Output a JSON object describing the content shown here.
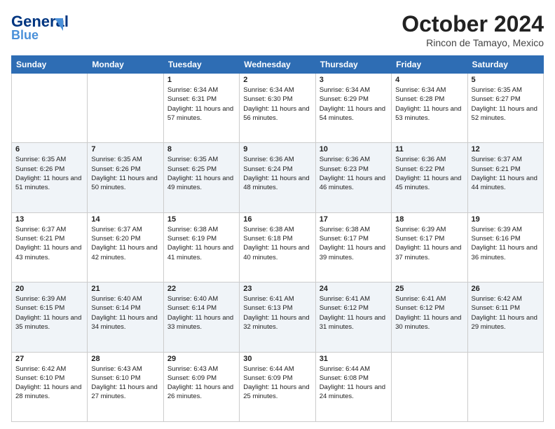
{
  "header": {
    "logo_line1": "General",
    "logo_line2": "Blue",
    "month": "October 2024",
    "location": "Rincon de Tamayo, Mexico"
  },
  "weekdays": [
    "Sunday",
    "Monday",
    "Tuesday",
    "Wednesday",
    "Thursday",
    "Friday",
    "Saturday"
  ],
  "weeks": [
    [
      {
        "day": "",
        "sunrise": "",
        "sunset": "",
        "daylight": ""
      },
      {
        "day": "",
        "sunrise": "",
        "sunset": "",
        "daylight": ""
      },
      {
        "day": "1",
        "sunrise": "Sunrise: 6:34 AM",
        "sunset": "Sunset: 6:31 PM",
        "daylight": "Daylight: 11 hours and 57 minutes."
      },
      {
        "day": "2",
        "sunrise": "Sunrise: 6:34 AM",
        "sunset": "Sunset: 6:30 PM",
        "daylight": "Daylight: 11 hours and 56 minutes."
      },
      {
        "day": "3",
        "sunrise": "Sunrise: 6:34 AM",
        "sunset": "Sunset: 6:29 PM",
        "daylight": "Daylight: 11 hours and 54 minutes."
      },
      {
        "day": "4",
        "sunrise": "Sunrise: 6:34 AM",
        "sunset": "Sunset: 6:28 PM",
        "daylight": "Daylight: 11 hours and 53 minutes."
      },
      {
        "day": "5",
        "sunrise": "Sunrise: 6:35 AM",
        "sunset": "Sunset: 6:27 PM",
        "daylight": "Daylight: 11 hours and 52 minutes."
      }
    ],
    [
      {
        "day": "6",
        "sunrise": "Sunrise: 6:35 AM",
        "sunset": "Sunset: 6:26 PM",
        "daylight": "Daylight: 11 hours and 51 minutes."
      },
      {
        "day": "7",
        "sunrise": "Sunrise: 6:35 AM",
        "sunset": "Sunset: 6:26 PM",
        "daylight": "Daylight: 11 hours and 50 minutes."
      },
      {
        "day": "8",
        "sunrise": "Sunrise: 6:35 AM",
        "sunset": "Sunset: 6:25 PM",
        "daylight": "Daylight: 11 hours and 49 minutes."
      },
      {
        "day": "9",
        "sunrise": "Sunrise: 6:36 AM",
        "sunset": "Sunset: 6:24 PM",
        "daylight": "Daylight: 11 hours and 48 minutes."
      },
      {
        "day": "10",
        "sunrise": "Sunrise: 6:36 AM",
        "sunset": "Sunset: 6:23 PM",
        "daylight": "Daylight: 11 hours and 46 minutes."
      },
      {
        "day": "11",
        "sunrise": "Sunrise: 6:36 AM",
        "sunset": "Sunset: 6:22 PM",
        "daylight": "Daylight: 11 hours and 45 minutes."
      },
      {
        "day": "12",
        "sunrise": "Sunrise: 6:37 AM",
        "sunset": "Sunset: 6:21 PM",
        "daylight": "Daylight: 11 hours and 44 minutes."
      }
    ],
    [
      {
        "day": "13",
        "sunrise": "Sunrise: 6:37 AM",
        "sunset": "Sunset: 6:21 PM",
        "daylight": "Daylight: 11 hours and 43 minutes."
      },
      {
        "day": "14",
        "sunrise": "Sunrise: 6:37 AM",
        "sunset": "Sunset: 6:20 PM",
        "daylight": "Daylight: 11 hours and 42 minutes."
      },
      {
        "day": "15",
        "sunrise": "Sunrise: 6:38 AM",
        "sunset": "Sunset: 6:19 PM",
        "daylight": "Daylight: 11 hours and 41 minutes."
      },
      {
        "day": "16",
        "sunrise": "Sunrise: 6:38 AM",
        "sunset": "Sunset: 6:18 PM",
        "daylight": "Daylight: 11 hours and 40 minutes."
      },
      {
        "day": "17",
        "sunrise": "Sunrise: 6:38 AM",
        "sunset": "Sunset: 6:17 PM",
        "daylight": "Daylight: 11 hours and 39 minutes."
      },
      {
        "day": "18",
        "sunrise": "Sunrise: 6:39 AM",
        "sunset": "Sunset: 6:17 PM",
        "daylight": "Daylight: 11 hours and 37 minutes."
      },
      {
        "day": "19",
        "sunrise": "Sunrise: 6:39 AM",
        "sunset": "Sunset: 6:16 PM",
        "daylight": "Daylight: 11 hours and 36 minutes."
      }
    ],
    [
      {
        "day": "20",
        "sunrise": "Sunrise: 6:39 AM",
        "sunset": "Sunset: 6:15 PM",
        "daylight": "Daylight: 11 hours and 35 minutes."
      },
      {
        "day": "21",
        "sunrise": "Sunrise: 6:40 AM",
        "sunset": "Sunset: 6:14 PM",
        "daylight": "Daylight: 11 hours and 34 minutes."
      },
      {
        "day": "22",
        "sunrise": "Sunrise: 6:40 AM",
        "sunset": "Sunset: 6:14 PM",
        "daylight": "Daylight: 11 hours and 33 minutes."
      },
      {
        "day": "23",
        "sunrise": "Sunrise: 6:41 AM",
        "sunset": "Sunset: 6:13 PM",
        "daylight": "Daylight: 11 hours and 32 minutes."
      },
      {
        "day": "24",
        "sunrise": "Sunrise: 6:41 AM",
        "sunset": "Sunset: 6:12 PM",
        "daylight": "Daylight: 11 hours and 31 minutes."
      },
      {
        "day": "25",
        "sunrise": "Sunrise: 6:41 AM",
        "sunset": "Sunset: 6:12 PM",
        "daylight": "Daylight: 11 hours and 30 minutes."
      },
      {
        "day": "26",
        "sunrise": "Sunrise: 6:42 AM",
        "sunset": "Sunset: 6:11 PM",
        "daylight": "Daylight: 11 hours and 29 minutes."
      }
    ],
    [
      {
        "day": "27",
        "sunrise": "Sunrise: 6:42 AM",
        "sunset": "Sunset: 6:10 PM",
        "daylight": "Daylight: 11 hours and 28 minutes."
      },
      {
        "day": "28",
        "sunrise": "Sunrise: 6:43 AM",
        "sunset": "Sunset: 6:10 PM",
        "daylight": "Daylight: 11 hours and 27 minutes."
      },
      {
        "day": "29",
        "sunrise": "Sunrise: 6:43 AM",
        "sunset": "Sunset: 6:09 PM",
        "daylight": "Daylight: 11 hours and 26 minutes."
      },
      {
        "day": "30",
        "sunrise": "Sunrise: 6:44 AM",
        "sunset": "Sunset: 6:09 PM",
        "daylight": "Daylight: 11 hours and 25 minutes."
      },
      {
        "day": "31",
        "sunrise": "Sunrise: 6:44 AM",
        "sunset": "Sunset: 6:08 PM",
        "daylight": "Daylight: 11 hours and 24 minutes."
      },
      {
        "day": "",
        "sunrise": "",
        "sunset": "",
        "daylight": ""
      },
      {
        "day": "",
        "sunrise": "",
        "sunset": "",
        "daylight": ""
      }
    ]
  ]
}
